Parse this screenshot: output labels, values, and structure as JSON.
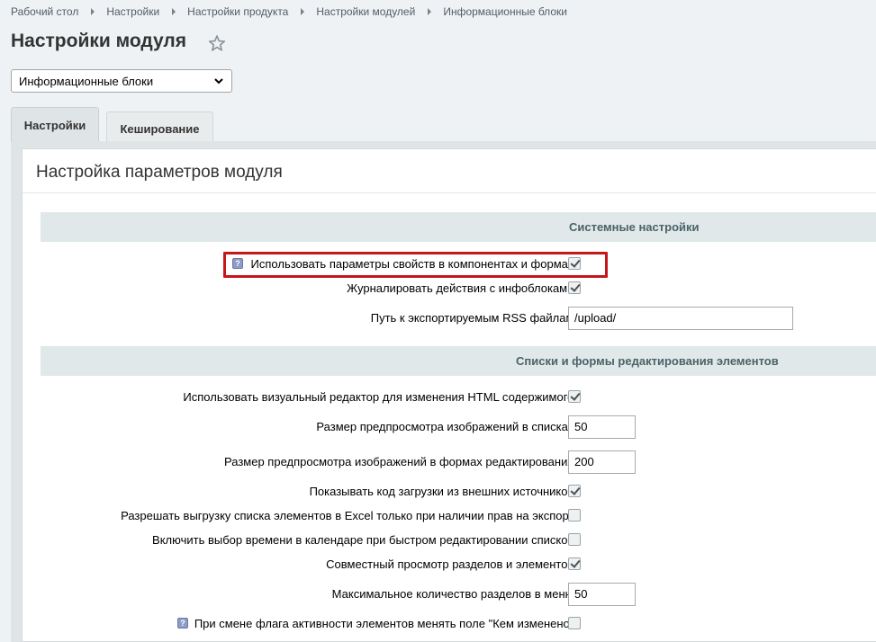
{
  "breadcrumb": [
    "Рабочий стол",
    "Настройки",
    "Настройки продукта",
    "Настройки модулей",
    "Информационные блоки"
  ],
  "page_title": "Настройки модуля",
  "module_select": {
    "value": "Информационные блоки"
  },
  "tabs": [
    {
      "label": "Настройки",
      "active": true
    },
    {
      "label": "Кеширование",
      "active": false
    }
  ],
  "panel_title": "Настройка параметров модуля",
  "sections": {
    "system": {
      "title": "Системные настройки",
      "rows": [
        {
          "label": "Использовать параметры свойств в компонентах и формах:",
          "checked": true,
          "help": true
        },
        {
          "label": "Журналировать действия с инфоблоками:",
          "checked": true
        },
        {
          "label": "Путь к экспортируемым RSS файлам:",
          "value": "/upload/"
        }
      ]
    },
    "lists": {
      "title": "Списки и формы редактирования элементов",
      "rows": [
        {
          "label": "Использовать визуальный редактор для изменения HTML содержимого:",
          "checked": true
        },
        {
          "label": "Размер предпросмотра изображений в списках:",
          "value": "50"
        },
        {
          "label": "Размер предпросмотра изображений в формах редактирования:",
          "value": "200"
        },
        {
          "label": "Показывать код загрузки из внешних источников:",
          "checked": true
        },
        {
          "label": "Разрешать выгрузку списка элементов в Excel только при наличии прав на экспорт:",
          "checked": false
        },
        {
          "label": "Включить выбор времени в календаре при быстром редактировании списков:",
          "checked": false
        },
        {
          "label": "Совместный просмотр разделов и элементов:",
          "checked": true
        },
        {
          "label": "Максимальное количество разделов в меню:",
          "value": "50"
        },
        {
          "label": "При смене флага активности элементов менять поле \"Кем изменено\":",
          "checked": false,
          "help": true
        }
      ]
    }
  },
  "colors": {
    "highlight": "#c4161c",
    "section_bg": "#e0e8ea",
    "tab_active_bg": "#dfe5e6"
  }
}
